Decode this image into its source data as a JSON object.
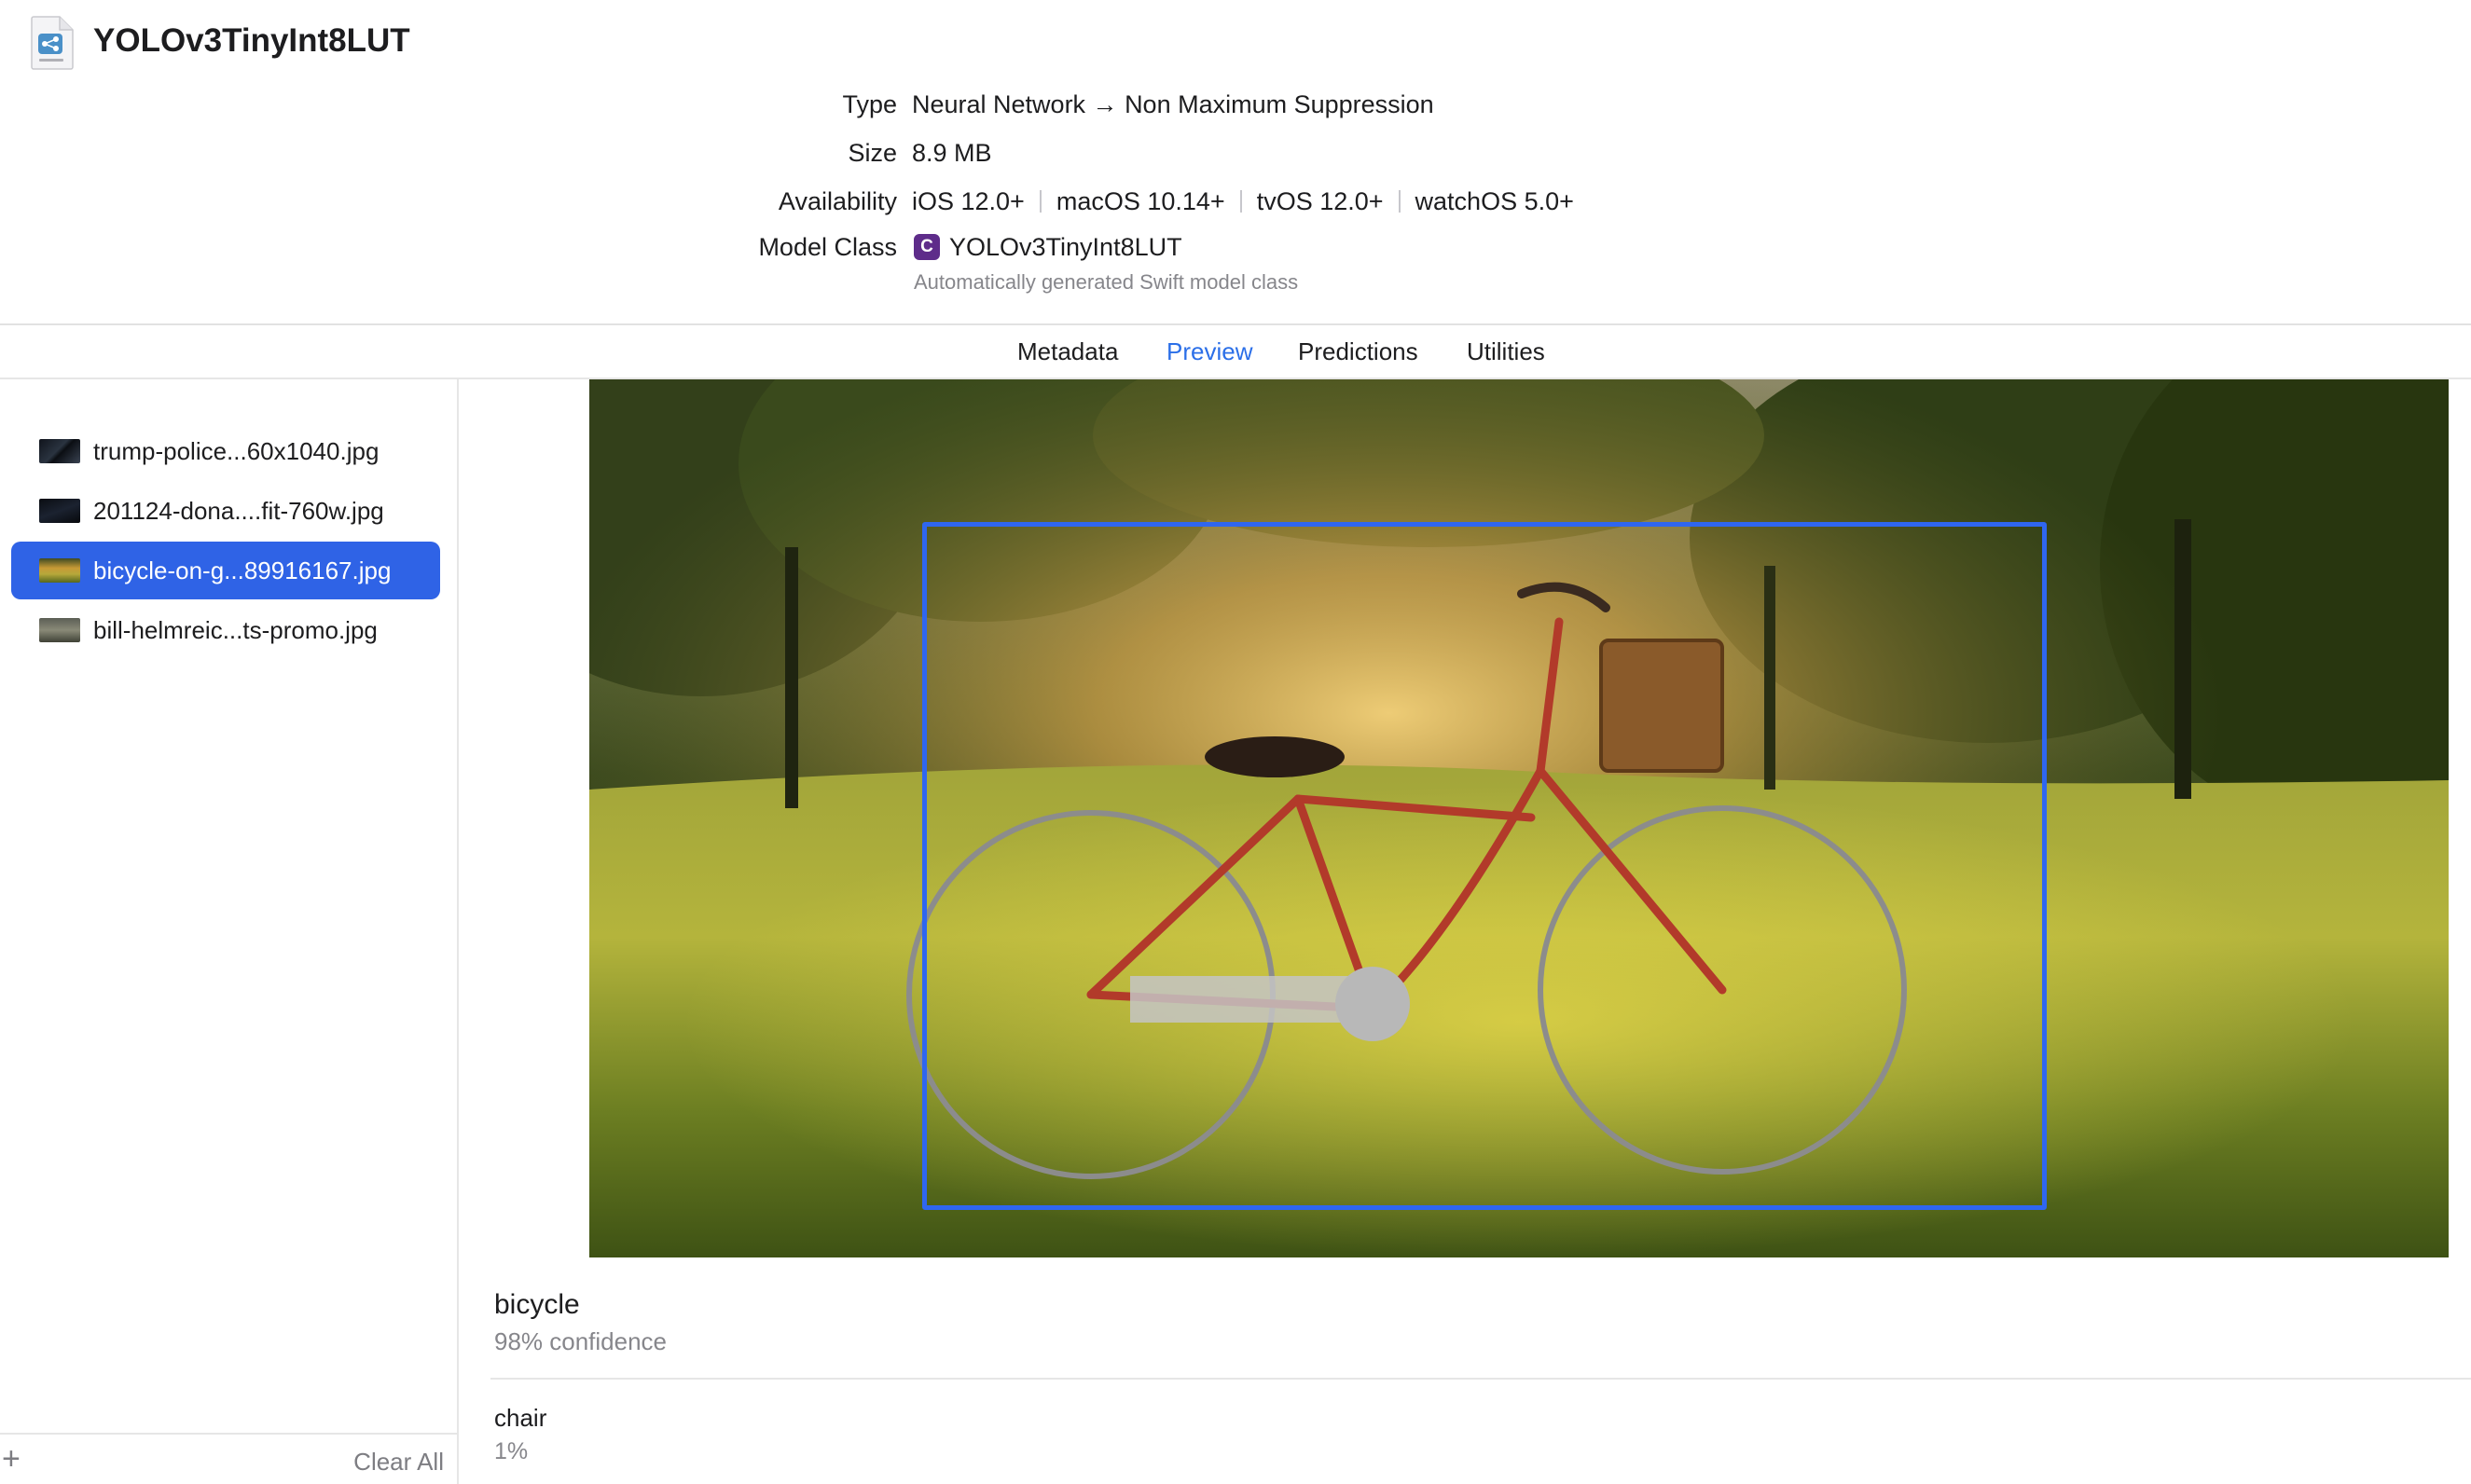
{
  "app": {
    "title": "YOLOv3TinyInt8LUT",
    "file_icon": "mlmodel-file-icon"
  },
  "info": {
    "type_label": "Type",
    "type_value": "Neural Network → Non Maximum Suppression",
    "size_label": "Size",
    "size_value": "8.9 MB",
    "availability_label": "Availability",
    "availability": [
      "iOS 12.0+",
      "macOS 10.14+",
      "tvOS 12.0+",
      "watchOS 5.0+"
    ],
    "model_class_label": "Model Class",
    "model_class_badge": "C",
    "model_class_name": "YOLOv3TinyInt8LUT",
    "model_class_desc": "Automatically generated Swift model class"
  },
  "tabs": [
    {
      "label": "Metadata",
      "active": false
    },
    {
      "label": "Preview",
      "active": true
    },
    {
      "label": "Predictions",
      "active": false
    },
    {
      "label": "Utilities",
      "active": false
    }
  ],
  "sidebar": {
    "files": [
      {
        "name": "trump-police...60x1040.jpg",
        "selected": false
      },
      {
        "name": "201124-dona....fit-760w.jpg",
        "selected": false
      },
      {
        "name": "bicycle-on-g...89916167.jpg",
        "selected": true
      },
      {
        "name": "bill-helmreic...ts-promo.jpg",
        "selected": false
      }
    ],
    "add_label": "+",
    "clear_all_label": "Clear All"
  },
  "predictions": [
    {
      "label": "bicycle",
      "confidence": "98% confidence"
    },
    {
      "label": "chair",
      "confidence": "1%"
    }
  ],
  "colors": {
    "accent": "#2f63e6",
    "detection_box": "#2f66f0",
    "active_tab": "#2b6fe8",
    "secondary_text": "#86868b"
  }
}
